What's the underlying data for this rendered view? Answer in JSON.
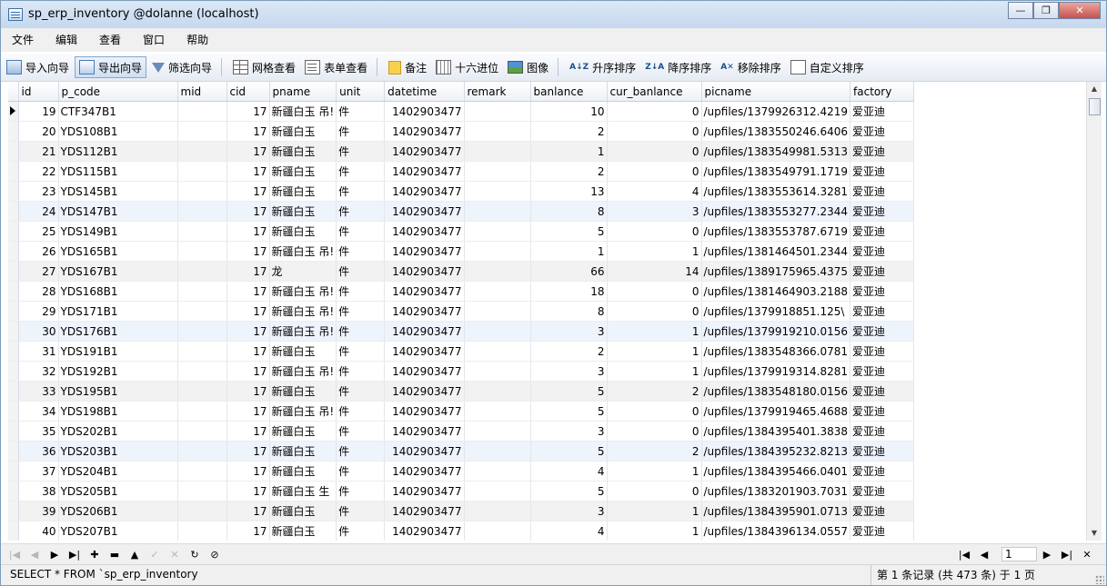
{
  "window": {
    "title": "sp_erp_inventory @dolanne (localhost)",
    "minimize": "—",
    "maximize": "❐",
    "close": "✕"
  },
  "menu": [
    "文件",
    "编辑",
    "查看",
    "窗口",
    "帮助"
  ],
  "toolbar": {
    "import_wizard": "导入向导",
    "export_wizard": "导出向导",
    "filter_wizard": "筛选向导",
    "grid_view": "网格查看",
    "form_view": "表单查看",
    "memo": "备注",
    "hex": "十六进位",
    "image": "图像",
    "sort_asc": "升序排序",
    "sort_desc": "降序排序",
    "remove_sort": "移除排序",
    "custom_sort": "自定义排序"
  },
  "table": {
    "columns": [
      "id",
      "p_code",
      "mid",
      "cid",
      "pname",
      "unit",
      "datetime",
      "remark",
      "banlance",
      "cur_banlance",
      "picname",
      "factory"
    ],
    "rows": [
      [
        "19",
        "CTF347B1",
        "",
        "17",
        "新疆白玉 吊!",
        "件",
        "1402903477",
        "",
        "10",
        "0",
        "/upfiles/1379926312.4219",
        "爱亚迪"
      ],
      [
        "20",
        "YDS108B1",
        "",
        "17",
        "新疆白玉",
        "件",
        "1402903477",
        "",
        "2",
        "0",
        "/upfiles/1383550246.6406",
        "爱亚迪"
      ],
      [
        "21",
        "YDS112B1",
        "",
        "17",
        "新疆白玉",
        "件",
        "1402903477",
        "",
        "1",
        "0",
        "/upfiles/1383549981.5313",
        "爱亚迪"
      ],
      [
        "22",
        "YDS115B1",
        "",
        "17",
        "新疆白玉",
        "件",
        "1402903477",
        "",
        "2",
        "0",
        "/upfiles/1383549791.1719",
        "爱亚迪"
      ],
      [
        "23",
        "YDS145B1",
        "",
        "17",
        "新疆白玉",
        "件",
        "1402903477",
        "",
        "13",
        "4",
        "/upfiles/1383553614.3281",
        "爱亚迪"
      ],
      [
        "24",
        "YDS147B1",
        "",
        "17",
        "新疆白玉",
        "件",
        "1402903477",
        "",
        "8",
        "3",
        "/upfiles/1383553277.2344",
        "爱亚迪"
      ],
      [
        "25",
        "YDS149B1",
        "",
        "17",
        "新疆白玉",
        "件",
        "1402903477",
        "",
        "5",
        "0",
        "/upfiles/1383553787.6719",
        "爱亚迪"
      ],
      [
        "26",
        "YDS165B1",
        "",
        "17",
        "新疆白玉 吊!",
        "件",
        "1402903477",
        "",
        "1",
        "1",
        "/upfiles/1381464501.2344",
        "爱亚迪"
      ],
      [
        "27",
        "YDS167B1",
        "",
        "17",
        "龙",
        "件",
        "1402903477",
        "",
        "66",
        "14",
        "/upfiles/1389175965.4375",
        "爱亚迪"
      ],
      [
        "28",
        "YDS168B1",
        "",
        "17",
        "新疆白玉 吊!",
        "件",
        "1402903477",
        "",
        "18",
        "0",
        "/upfiles/1381464903.2188",
        "爱亚迪"
      ],
      [
        "29",
        "YDS171B1",
        "",
        "17",
        "新疆白玉 吊!",
        "件",
        "1402903477",
        "",
        "8",
        "0",
        "/upfiles/1379918851.125\\",
        "爱亚迪"
      ],
      [
        "30",
        "YDS176B1",
        "",
        "17",
        "新疆白玉 吊!",
        "件",
        "1402903477",
        "",
        "3",
        "1",
        "/upfiles/1379919210.0156",
        "爱亚迪"
      ],
      [
        "31",
        "YDS191B1",
        "",
        "17",
        "新疆白玉",
        "件",
        "1402903477",
        "",
        "2",
        "1",
        "/upfiles/1383548366.0781",
        "爱亚迪"
      ],
      [
        "32",
        "YDS192B1",
        "",
        "17",
        "新疆白玉 吊!",
        "件",
        "1402903477",
        "",
        "3",
        "1",
        "/upfiles/1379919314.8281",
        "爱亚迪"
      ],
      [
        "33",
        "YDS195B1",
        "",
        "17",
        "新疆白玉",
        "件",
        "1402903477",
        "",
        "5",
        "2",
        "/upfiles/1383548180.0156",
        "爱亚迪"
      ],
      [
        "34",
        "YDS198B1",
        "",
        "17",
        "新疆白玉 吊!",
        "件",
        "1402903477",
        "",
        "5",
        "0",
        "/upfiles/1379919465.4688",
        "爱亚迪"
      ],
      [
        "35",
        "YDS202B1",
        "",
        "17",
        "新疆白玉",
        "件",
        "1402903477",
        "",
        "3",
        "0",
        "/upfiles/1384395401.3838",
        "爱亚迪"
      ],
      [
        "36",
        "YDS203B1",
        "",
        "17",
        "新疆白玉",
        "件",
        "1402903477",
        "",
        "5",
        "2",
        "/upfiles/1384395232.8213",
        "爱亚迪"
      ],
      [
        "37",
        "YDS204B1",
        "",
        "17",
        "新疆白玉",
        "件",
        "1402903477",
        "",
        "4",
        "1",
        "/upfiles/1384395466.0401",
        "爱亚迪"
      ],
      [
        "38",
        "YDS205B1",
        "",
        "17",
        "新疆白玉 生",
        "件",
        "1402903477",
        "",
        "5",
        "0",
        "/upfiles/1383201903.7031",
        "爱亚迪"
      ],
      [
        "39",
        "YDS206B1",
        "",
        "17",
        "新疆白玉",
        "件",
        "1402903477",
        "",
        "3",
        "1",
        "/upfiles/1384395901.0713",
        "爱亚迪"
      ],
      [
        "40",
        "YDS207B1",
        "",
        "17",
        "新疆白玉",
        "件",
        "1402903477",
        "",
        "4",
        "1",
        "/upfiles/1384396134.0557",
        "爱亚迪"
      ]
    ]
  },
  "pager": {
    "page": "1"
  },
  "status": {
    "sql": "SELECT * FROM `sp_erp_inventory",
    "record_info": "第 1 条记录 (共 473 条) 于 1 页"
  }
}
